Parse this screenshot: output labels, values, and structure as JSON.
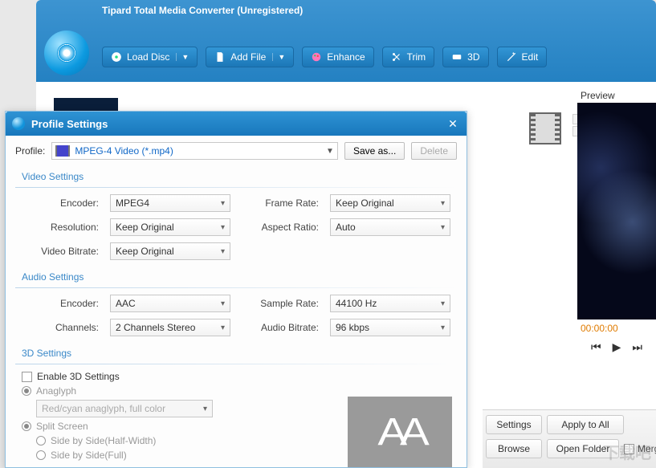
{
  "app": {
    "title": "Tipard Total Media Converter (Unregistered)"
  },
  "toolbar": {
    "load_disc": "Load Disc",
    "add_file": "Add File",
    "enhance": "Enhance",
    "trim": "Trim",
    "threeD": "3D",
    "edit": "Edit"
  },
  "preview": {
    "label": "Preview",
    "timecode": "00:00:00"
  },
  "bottom": {
    "settings": "Settings",
    "apply_all": "Apply to All",
    "browse": "Browse",
    "open_folder": "Open Folder",
    "merge": "Merge"
  },
  "dialog": {
    "title": "Profile Settings",
    "close": "×",
    "profile_label": "Profile:",
    "profile_value": "MPEG-4 Video (*.mp4)",
    "save_as": "Save as...",
    "delete": "Delete",
    "video_section": "Video Settings",
    "audio_section": "Audio Settings",
    "threed_section": "3D Settings",
    "video": {
      "encoder_label": "Encoder:",
      "encoder": "MPEG4",
      "resolution_label": "Resolution:",
      "resolution": "Keep Original",
      "bitrate_label": "Video Bitrate:",
      "bitrate": "Keep Original",
      "framerate_label": "Frame Rate:",
      "framerate": "Keep Original",
      "aspect_label": "Aspect Ratio:",
      "aspect": "Auto"
    },
    "audio": {
      "encoder_label": "Encoder:",
      "encoder": "AAC",
      "channels_label": "Channels:",
      "channels": "2 Channels Stereo",
      "samplerate_label": "Sample Rate:",
      "samplerate": "44100 Hz",
      "bitrate_label": "Audio Bitrate:",
      "bitrate": "96 kbps"
    },
    "threed": {
      "enable": "Enable 3D Settings",
      "anaglyph": "Anaglyph",
      "anaglyph_mode": "Red/cyan anaglyph, full color",
      "split": "Split Screen",
      "sbs_half": "Side by Side(Half-Width)",
      "sbs_full": "Side by Side(Full)"
    }
  },
  "watermark": "下载吧"
}
